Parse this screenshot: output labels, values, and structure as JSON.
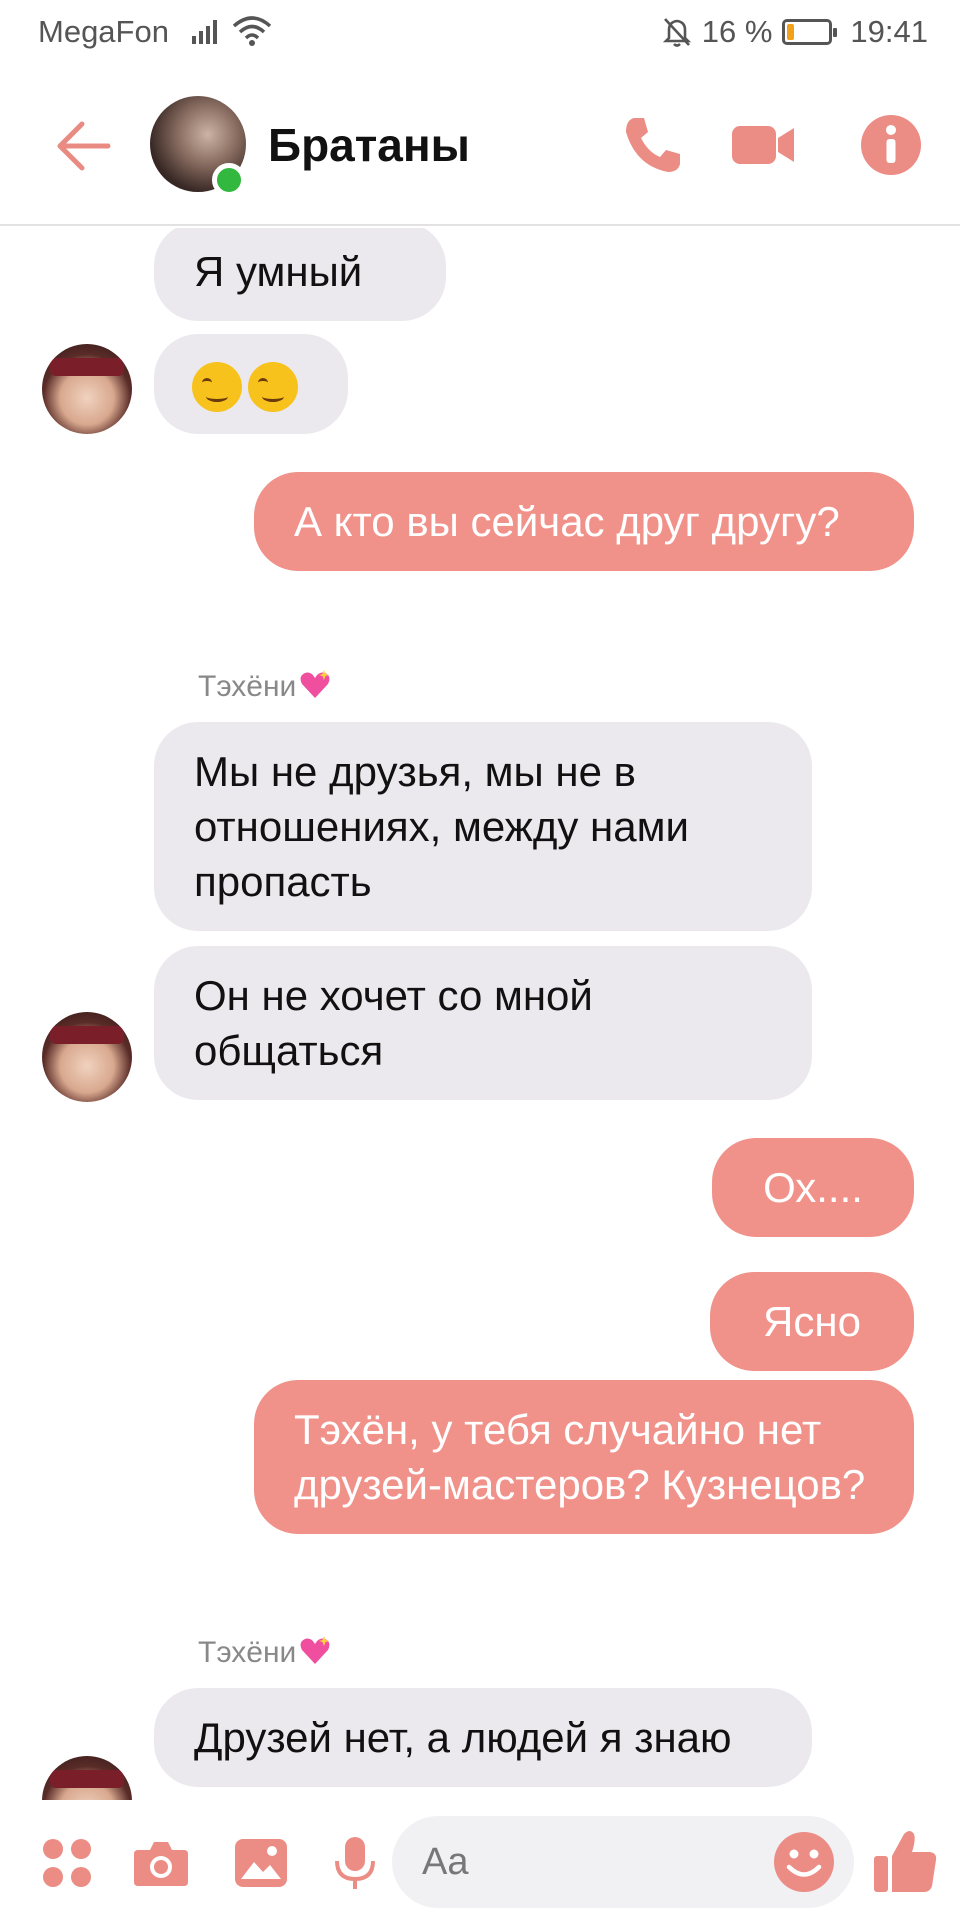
{
  "status_bar": {
    "carrier": "MegaFon",
    "battery_text": "16 %",
    "battery_level": 0.16,
    "time": "19:41"
  },
  "header": {
    "title": "Братаны",
    "icons": [
      "back-arrow-icon",
      "phone-icon",
      "video-camera-icon",
      "info-icon"
    ]
  },
  "messages": [
    {
      "direction": "in",
      "text": "Я умный"
    },
    {
      "direction": "in",
      "emoji": [
        "woozy-face",
        "woozy-face"
      ]
    },
    {
      "direction": "out",
      "text": "А кто вы сейчас друг другу?"
    },
    {
      "direction": "in",
      "sender": "Тэхёни",
      "sender_emoji": "sparkling-heart",
      "text": "Мы не друзья, мы не в отношениях, между нами пропасть"
    },
    {
      "direction": "in",
      "text": "Он не хочет со мной общаться"
    },
    {
      "direction": "out",
      "text": "Ох...."
    },
    {
      "direction": "out",
      "text": "Ясно"
    },
    {
      "direction": "out",
      "text": "Тэхён, у тебя случайно нет друзей-мастеров? Кузнецов?"
    },
    {
      "direction": "in",
      "sender": "Тэхёни",
      "sender_emoji": "sparkling-heart",
      "text": "Друзей нет, а людей я знаю"
    }
  ],
  "composer": {
    "placeholder": "Aa",
    "icons": [
      "apps-icon",
      "camera-icon",
      "gallery-icon",
      "microphone-icon",
      "emoji-icon",
      "thumbs-up-icon"
    ]
  },
  "colors": {
    "accent": "#f0928a",
    "incoming_bubble": "#ebe9ee",
    "online": "#33b83f"
  }
}
